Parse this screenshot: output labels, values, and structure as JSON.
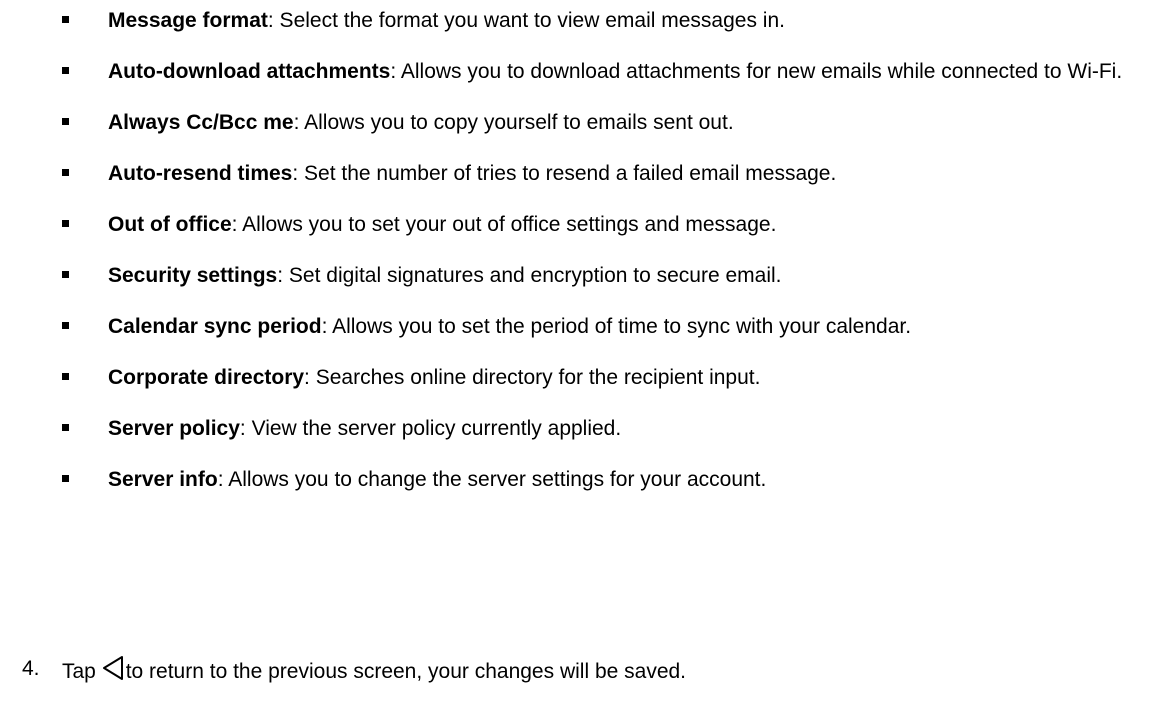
{
  "settings_list": [
    {
      "term": "Message format",
      "description": ": Select the format you want to view email messages in."
    },
    {
      "term": "Auto-download attachments",
      "description": ": Allows you to download attachments for new emails while connected to Wi-Fi."
    },
    {
      "term": "Always Cc/Bcc me",
      "description": ": Allows you to copy yourself to emails sent out."
    },
    {
      "term": "Auto-resend times",
      "description": ": Set the number of tries to resend a failed email message."
    },
    {
      "term": "Out of office",
      "description": ": Allows you to set your out of office settings and message."
    },
    {
      "term": "Security settings",
      "description": ": Set digital signatures and encryption to secure email."
    },
    {
      "term": "Calendar sync period",
      "description": ": Allows you to set the period of time to sync with your calendar."
    },
    {
      "term": "Corporate directory",
      "description": ": Searches online directory for the recipient input."
    },
    {
      "term": "Server policy",
      "description": ": View the server policy currently applied."
    },
    {
      "term": "Server info",
      "description": ": Allows you to change the server settings for your account."
    }
  ],
  "step": {
    "number": "4.",
    "before_icon": "Tap",
    "icon": "back-triangle-icon",
    "after_icon": "to return to the previous screen, your changes will be saved."
  }
}
